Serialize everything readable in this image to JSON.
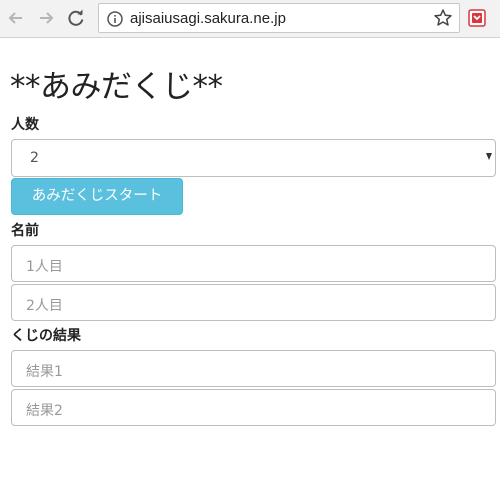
{
  "browser": {
    "url": "ajisaiusagi.sakura.ne.jp",
    "icons": {
      "back": "back-arrow-icon",
      "forward": "forward-arrow-icon",
      "reload": "reload-icon",
      "info": "info-icon",
      "bookmark": "star-icon",
      "extension": "extension-icon"
    },
    "extension_color": "#d9363e"
  },
  "page": {
    "title": "**あみだくじ**",
    "people_label": "人数",
    "people_select": {
      "value": "2"
    },
    "start_button": "あみだくじスタート",
    "names_label": "名前",
    "name_inputs": [
      {
        "placeholder": "1人目"
      },
      {
        "placeholder": "2人目"
      }
    ],
    "results_label": "くじの結果",
    "result_inputs": [
      {
        "placeholder": "結果1"
      },
      {
        "placeholder": "結果2"
      }
    ]
  },
  "colors": {
    "button_bg": "#5bc0de",
    "button_border": "#46b8da",
    "button_text": "#ffffff"
  }
}
